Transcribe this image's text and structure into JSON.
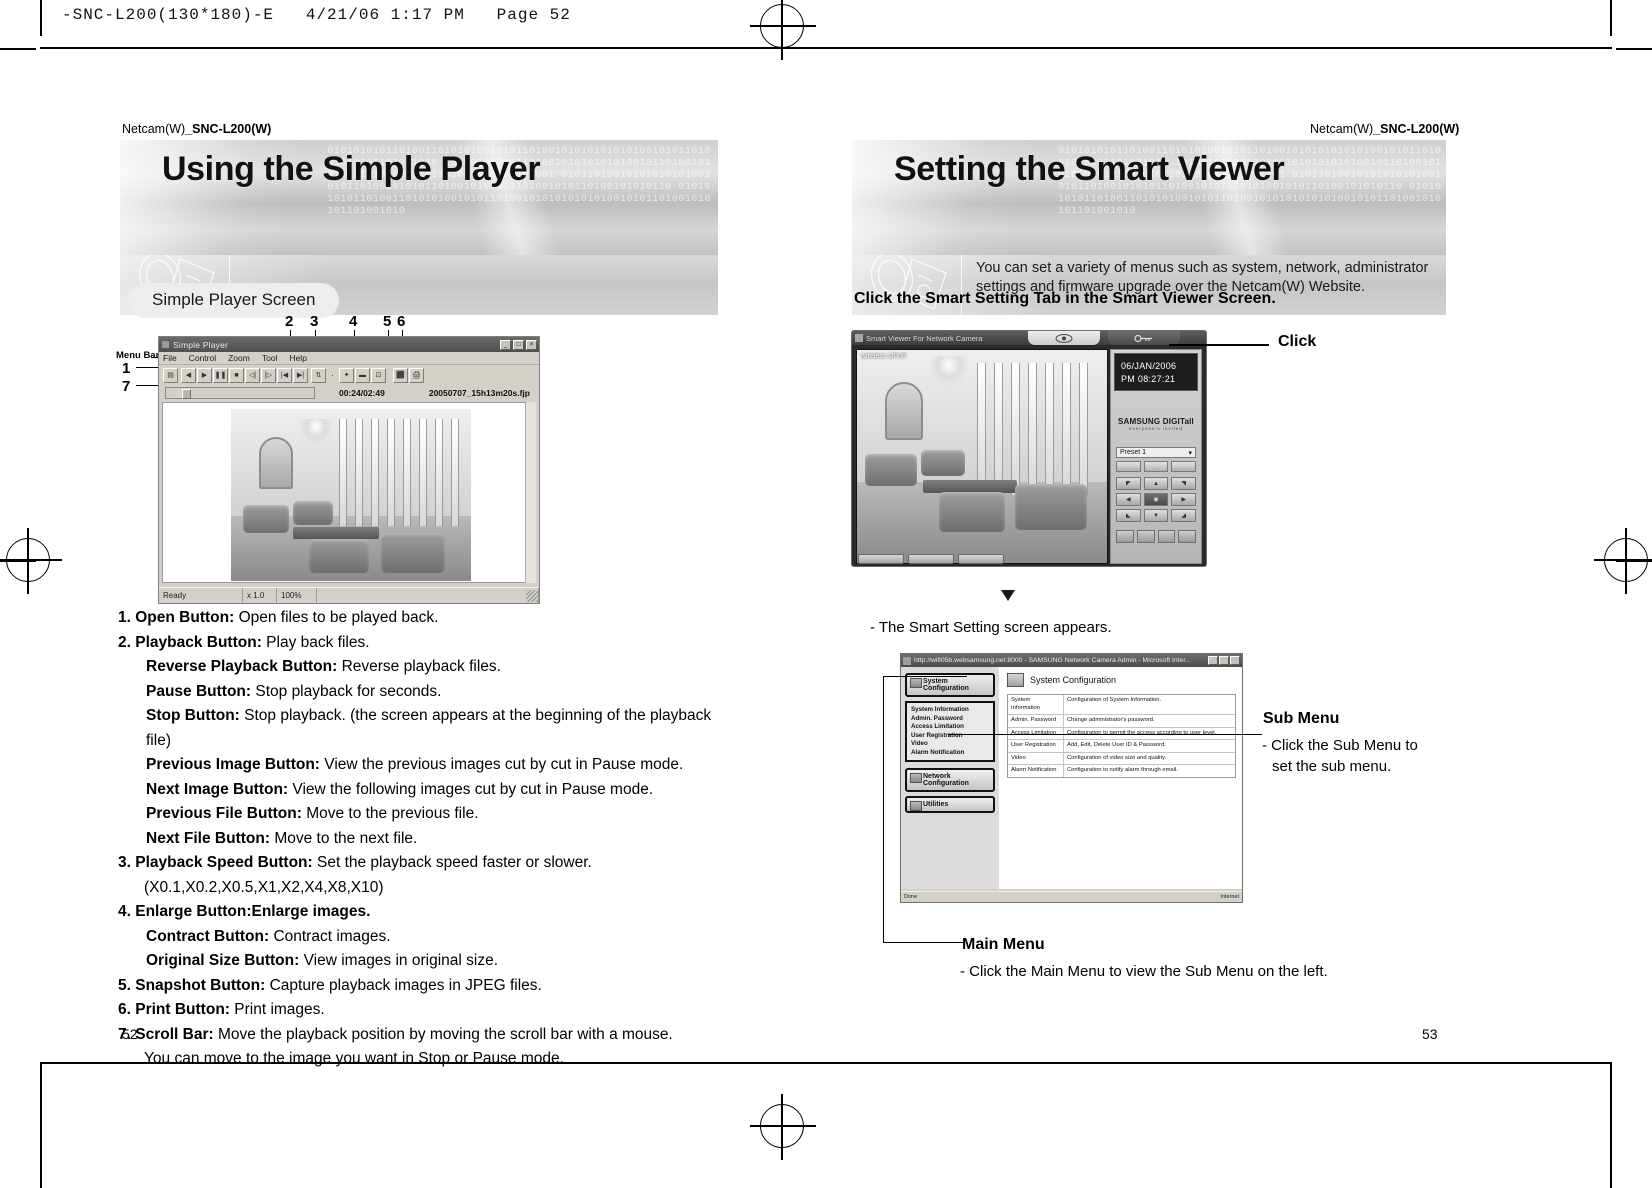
{
  "print_slug": "-SNC-L200(130*180)-E   4/21/06 1:17 PM   Page 52",
  "left_page": {
    "running_head_light": "Netcam(W)",
    "running_head_bold": "_SNC-L200(W)",
    "banner_title": "Using the Simple Player",
    "pill_label": "Simple Player Screen",
    "menu_bar_label": "Menu Bar",
    "callouts": [
      "1",
      "2",
      "3",
      "4",
      "5",
      "6",
      "7"
    ],
    "player": {
      "window_title": "Simple Player",
      "menu_items": [
        "File",
        "Control",
        "Zoom",
        "Tool",
        "Help"
      ],
      "time_display": "00:24/02:49",
      "file_name": "20050707_15h13m20s.fjp",
      "status_ready": "Ready",
      "status_speed": "x 1.0",
      "status_zoom": "100%",
      "title_buttons": [
        "_",
        "□",
        "×"
      ]
    },
    "items": [
      {
        "num": "1.",
        "term": "Open Button:",
        "desc": "Open files to be played back.",
        "indent": false
      },
      {
        "num": "2.",
        "term": "Playback Button:",
        "desc": "Play back files.",
        "indent": false
      },
      {
        "num": "",
        "term": "Reverse Playback Button:",
        "desc": "Reverse playback files.",
        "indent": true
      },
      {
        "num": "",
        "term": "Pause Button:",
        "desc": "Stop playback for seconds.",
        "indent": true
      },
      {
        "num": "",
        "term": "Stop Button:",
        "desc": "Stop playback. (the screen appears at the beginning of the playback file)",
        "indent": true
      },
      {
        "num": "",
        "term": "Previous Image Button:",
        "desc": "View the previous images cut by cut in Pause mode.",
        "indent": true
      },
      {
        "num": "",
        "term": "Next Image Button:",
        "desc": "View the following images cut by cut in Pause mode.",
        "indent": true
      },
      {
        "num": "",
        "term": "Previous File Button:",
        "desc": "Move to the previous file.",
        "indent": true
      },
      {
        "num": "",
        "term": "Next File Button:",
        "desc": "Move to the next file.",
        "indent": true
      },
      {
        "num": "3.",
        "term": "Playback Speed Button:",
        "desc": "Set the playback speed faster or slower.",
        "indent": false
      },
      {
        "num": "",
        "term": "",
        "desc": "(X0.1,X0.2,X0.5,X1,X2,X4,X8,X10)",
        "indent": false,
        "plain": true
      },
      {
        "num": "4.",
        "term": "Enlarge Button:Enlarge images.",
        "desc": "",
        "indent": false
      },
      {
        "num": "",
        "term": "Contract Button:",
        "desc": "Contract images.",
        "indent": true
      },
      {
        "num": "",
        "term": "Original Size Button:",
        "desc": "View images in original size.",
        "indent": true
      },
      {
        "num": "5.",
        "term": "Snapshot Button:",
        "desc": "Capture playback images in JPEG files.",
        "indent": false
      },
      {
        "num": "6.",
        "term": "Print Button:",
        "desc": "Print images.",
        "indent": false
      },
      {
        "num": "7.",
        "term": "Scroll Bar:",
        "desc": "Move the playback position by moving the scroll bar with a mouse.",
        "indent": false
      },
      {
        "num": "",
        "term": "",
        "desc": "You can move to the image you want in Stop or Pause mode.",
        "indent": false,
        "plain": true
      }
    ],
    "page_number": "52"
  },
  "right_page": {
    "running_head_light": "Netcam(W)",
    "running_head_bold": "_SNC-L200(W)",
    "banner_title": "Setting the Smart Viewer",
    "banner_lead": "You can set a variety of menus such as system, network, administrator settings and firmware upgrade over the Netcam(W) Website.",
    "instruction": "Click the Smart Setting Tab in the Smart Viewer Screen.",
    "click_label": "Click",
    "appears_note": "- The Smart Setting screen appears.",
    "sub_menu_title": "Sub Menu",
    "sub_menu_note_line1": "- Click the Sub Menu to",
    "sub_menu_note_line2": "set the sub menu.",
    "main_menu_title": "Main Menu",
    "main_menu_note": "- Click the Main Menu to view the Sub Menu on the left.",
    "smart_viewer": {
      "window_title": "Smart Viewer For Network Camera",
      "upnp_label": "wireless UPnP",
      "date": "06/JAN/2006",
      "time": "PM 08:27:21",
      "brand": "SAMSUNG DIGITall",
      "brand_tagline": "everyone's invited",
      "preset_label": "Preset 1"
    },
    "browser": {
      "window_title": "http://wifi05b.websamsung.net:8000 - SAMSUNG Network Camera Admin - Microsoft Inter...",
      "nav_buttons": [
        "System Configuration",
        "Network Configuration",
        "Utilities"
      ],
      "sub_items": [
        "System Information",
        "Admin. Password",
        "Access Limitation",
        "User Registration",
        "Video",
        "Alarm Notification"
      ],
      "panel_title": "System Configuration",
      "table": [
        {
          "name": "System Information",
          "desc": "Configuration of System Information."
        },
        {
          "name": "Admin. Password",
          "desc": "Change administrator's password."
        },
        {
          "name": "Access Limitation",
          "desc": "Configuration to permit the access according to user level."
        },
        {
          "name": "User Registration",
          "desc": "Add, Edit, Delete User ID & Password."
        },
        {
          "name": "Video",
          "desc": "Configuration of video size and quality."
        },
        {
          "name": "Alarm Notification",
          "desc": "Configuration to notify alarm through email."
        }
      ],
      "status_left": "Done",
      "status_right": "Internet"
    },
    "page_number": "53"
  }
}
